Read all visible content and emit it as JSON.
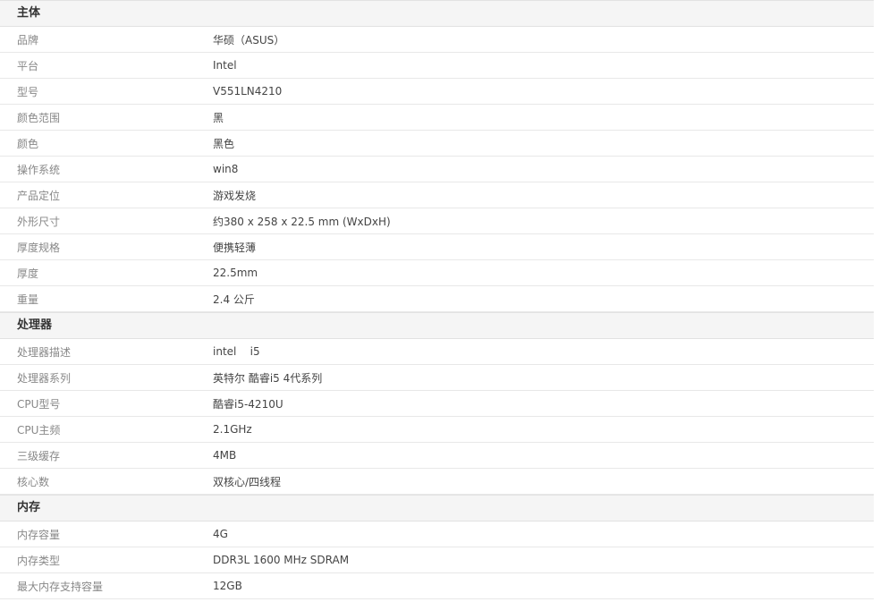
{
  "sections": [
    {
      "title": "主体",
      "rows": [
        {
          "label": "品牌",
          "value": "华硕（ASUS）"
        },
        {
          "label": "平台",
          "value": "Intel"
        },
        {
          "label": "型号",
          "value": "V551LN4210"
        },
        {
          "label": "颜色范围",
          "value": "黑"
        },
        {
          "label": "颜色",
          "value": "黑色"
        },
        {
          "label": "操作系统",
          "value": "win8"
        },
        {
          "label": "产品定位",
          "value": "游戏发烧"
        },
        {
          "label": "外形尺寸",
          "value": "约380 x 258 x 22.5 mm (WxDxH)"
        },
        {
          "label": "厚度规格",
          "value": "便携轻薄"
        },
        {
          "label": "厚度",
          "value": "22.5mm"
        },
        {
          "label": "重量",
          "value": "2.4 公斤"
        }
      ]
    },
    {
      "title": "处理器",
      "rows": [
        {
          "label": "处理器描述",
          "value": "intel    i5"
        },
        {
          "label": "处理器系列",
          "value": "英特尔 酷睿i5 4代系列"
        },
        {
          "label": "CPU型号",
          "value": "酷睿i5-4210U"
        },
        {
          "label": "CPU主频",
          "value": "2.1GHz"
        },
        {
          "label": "三级缓存",
          "value": "4MB"
        },
        {
          "label": "核心数",
          "value": "双核心/四线程"
        }
      ]
    },
    {
      "title": "内存",
      "rows": [
        {
          "label": "内存容量",
          "value": "4G"
        },
        {
          "label": "内存类型",
          "value": "DDR3L 1600 MHz SDRAM"
        },
        {
          "label": "最大内存支持容量",
          "value": "12GB"
        }
      ]
    }
  ]
}
